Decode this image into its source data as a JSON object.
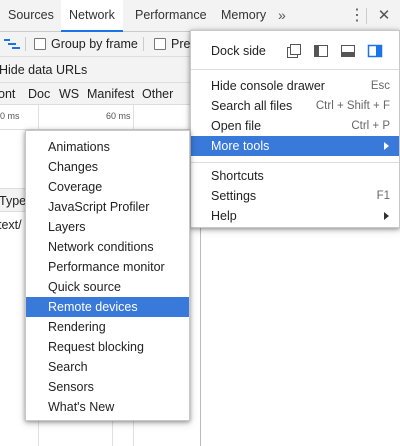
{
  "tabbar": {
    "tabs": [
      {
        "label": "Sources",
        "active": false
      },
      {
        "label": "Network",
        "active": true
      },
      {
        "label": "Performance",
        "active": false
      },
      {
        "label": "Memory",
        "active": false
      }
    ],
    "more_label": "»",
    "kebab_label": "⋮",
    "close_label": "✕"
  },
  "network_toolbar": {
    "group_by_frame": "Group by frame",
    "preserve_log_partial": "Pre",
    "hide_data_urls": "Hide data URLs",
    "filters": [
      "ont",
      "Doc",
      "WS",
      "Manifest",
      "Other"
    ],
    "timeline_left": "0 ms",
    "timeline_right": "60 ms",
    "col_type_partial": "Type",
    "cell_partial": "text/"
  },
  "main_menu": {
    "dock_side_label": "Dock side",
    "items": [
      {
        "label": "Hide console drawer",
        "shortcut": "Esc"
      },
      {
        "label": "Search all files",
        "shortcut": "Ctrl + Shift + F"
      },
      {
        "label": "Open file",
        "shortcut": "Ctrl + P"
      },
      {
        "label": "More tools",
        "shortcut": "",
        "submenu": true,
        "highlighted": true
      },
      {
        "label": "Shortcuts",
        "shortcut": ""
      },
      {
        "label": "Settings",
        "shortcut": "F1"
      },
      {
        "label": "Help",
        "shortcut": "",
        "submenu": true
      }
    ]
  },
  "more_tools_menu": {
    "items": [
      "Animations",
      "Changes",
      "Coverage",
      "JavaScript Profiler",
      "Layers",
      "Network conditions",
      "Performance monitor",
      "Quick source",
      "Remote devices",
      "Rendering",
      "Request blocking",
      "Search",
      "Sensors",
      "What's New"
    ],
    "highlighted": "Remote devices"
  },
  "colors": {
    "highlight": "#3879d9",
    "active_tab_underline": "#1a73e8",
    "dock_accent": "#1a73e8"
  }
}
